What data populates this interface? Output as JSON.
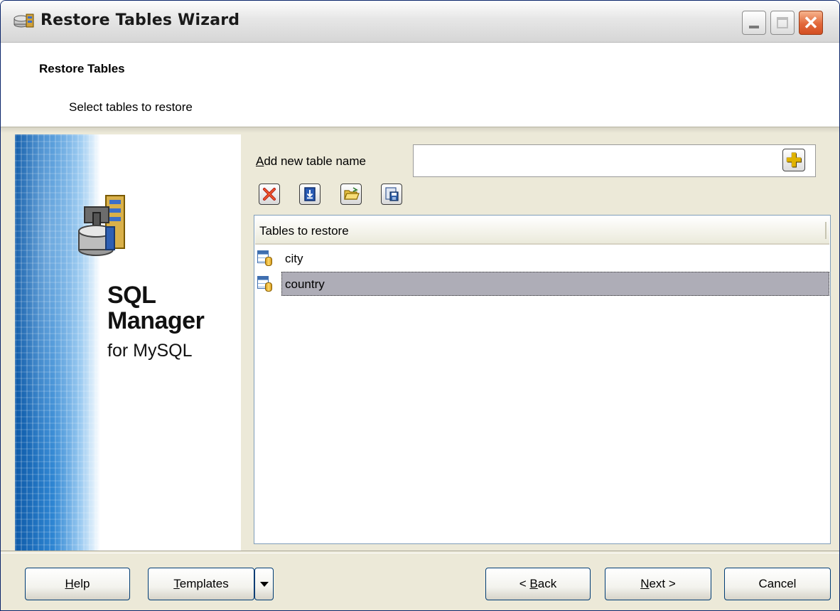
{
  "window": {
    "title": "Restore Tables Wizard",
    "controls": {
      "minimize": "minimize",
      "maximize": "maximize",
      "close": "close"
    }
  },
  "header": {
    "title": "Restore Tables",
    "subtitle": "Select tables to restore"
  },
  "banner": {
    "line1": "SQL",
    "line2": "Manager",
    "line3": "for MySQL"
  },
  "add": {
    "label_prefix": "A",
    "label_rest": "dd new table name",
    "value": "",
    "add_icon": "plus-icon"
  },
  "toolbar": {
    "icons": [
      "delete-icon",
      "load-icon",
      "open-icon",
      "save-icon"
    ]
  },
  "list": {
    "header": "Tables to restore",
    "rows": [
      {
        "label": "city",
        "selected": false
      },
      {
        "label": "country",
        "selected": true
      }
    ]
  },
  "buttons": {
    "help_u": "H",
    "help_rest": "elp",
    "templates_u": "T",
    "templates_rest": "emplates",
    "back_pre": "< ",
    "back_u": "B",
    "back_rest": "ack",
    "next_u": "N",
    "next_rest": "ext >",
    "cancel": "Cancel"
  },
  "colors": {
    "selection": "#aeadb7",
    "dialog_bg": "#ece9d8",
    "button_border": "#003c74",
    "list_border": "#7f9db9"
  }
}
